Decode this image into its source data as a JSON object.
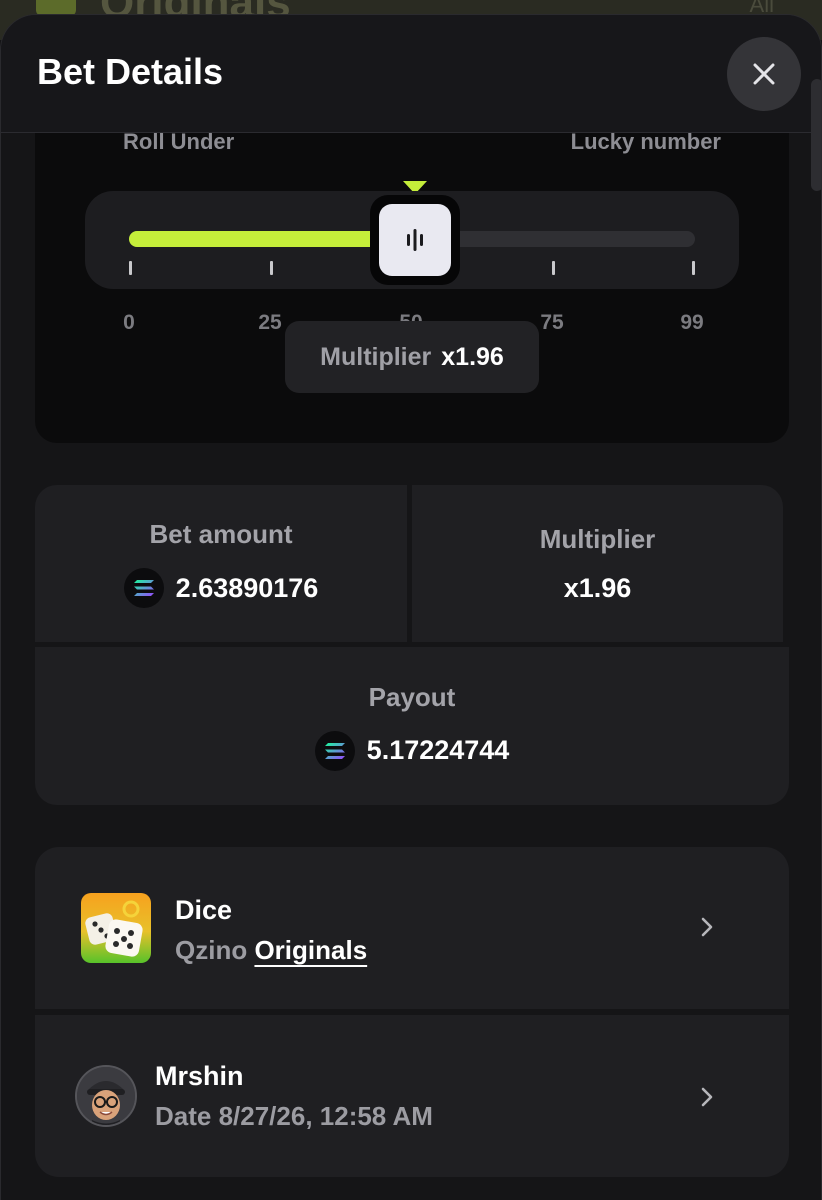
{
  "backdrop": {
    "title": "Originals",
    "right_text": "All"
  },
  "header": {
    "title": "Bet Details",
    "close_icon": "close-icon"
  },
  "game": {
    "roll_label": "Roll Under",
    "lucky_label": "Lucky number",
    "slider_value": 50,
    "slider_min": 0,
    "slider_max": 99,
    "scale": [
      "0",
      "25",
      "50",
      "75",
      "99"
    ],
    "multiplier_label": "Multiplier",
    "multiplier_value": "x1.96",
    "accent_color": "#c5ee3a"
  },
  "stats": {
    "bet_label": "Bet amount",
    "bet_value": "2.63890176",
    "mult_label": "Multiplier",
    "mult_value": "x1.96",
    "payout_label": "Payout",
    "payout_value": "5.17224744",
    "coin_icon": "solana-icon"
  },
  "game_row": {
    "title": "Dice",
    "provider": "Qzino",
    "link": "Originals"
  },
  "user_row": {
    "name": "Mrshin",
    "date": "Date 8/27/26, 12:58 AM"
  }
}
